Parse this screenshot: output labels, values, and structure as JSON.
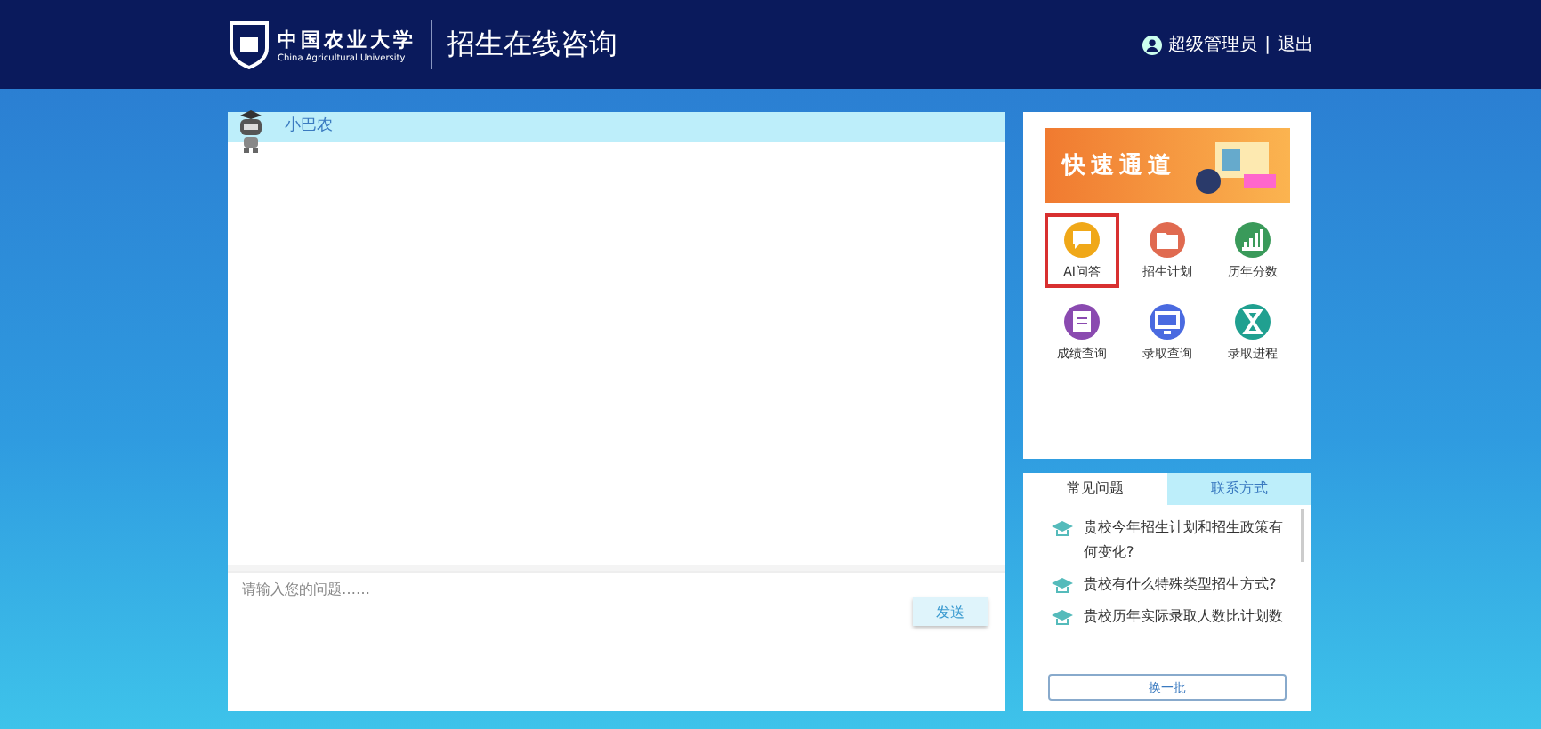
{
  "header": {
    "logo_cn": "中国农业大学",
    "logo_en": "China Agricultural University",
    "title": "招生在线咨询",
    "user": "超级管理员",
    "separator": "|",
    "logout": "退出"
  },
  "chat": {
    "bot_name": "小巴农",
    "input": {
      "placeholder": "请输入您的问题……"
    },
    "send": "发送"
  },
  "quick": {
    "banner": "快速通道",
    "items": [
      {
        "label": "AI问答",
        "color": "#f0a818",
        "selected": true
      },
      {
        "label": "招生计划",
        "color": "#e06a50",
        "selected": false
      },
      {
        "label": "历年分数",
        "color": "#3a9a5a",
        "selected": false
      },
      {
        "label": "成绩查询",
        "color": "#8a4ab0",
        "selected": false
      },
      {
        "label": "录取查询",
        "color": "#4a6ae0",
        "selected": false
      },
      {
        "label": "录取进程",
        "color": "#20a090",
        "selected": false
      }
    ]
  },
  "faq": {
    "tabs": [
      {
        "label": "常见问题",
        "selected": true
      },
      {
        "label": "联系方式",
        "selected": false
      }
    ],
    "questions": [
      "贵校今年招生计划和招生政策有何变化?",
      "贵校有什么特殊类型招生方式?",
      "贵校历年实际录取人数比计划数"
    ],
    "more": "换一批"
  }
}
